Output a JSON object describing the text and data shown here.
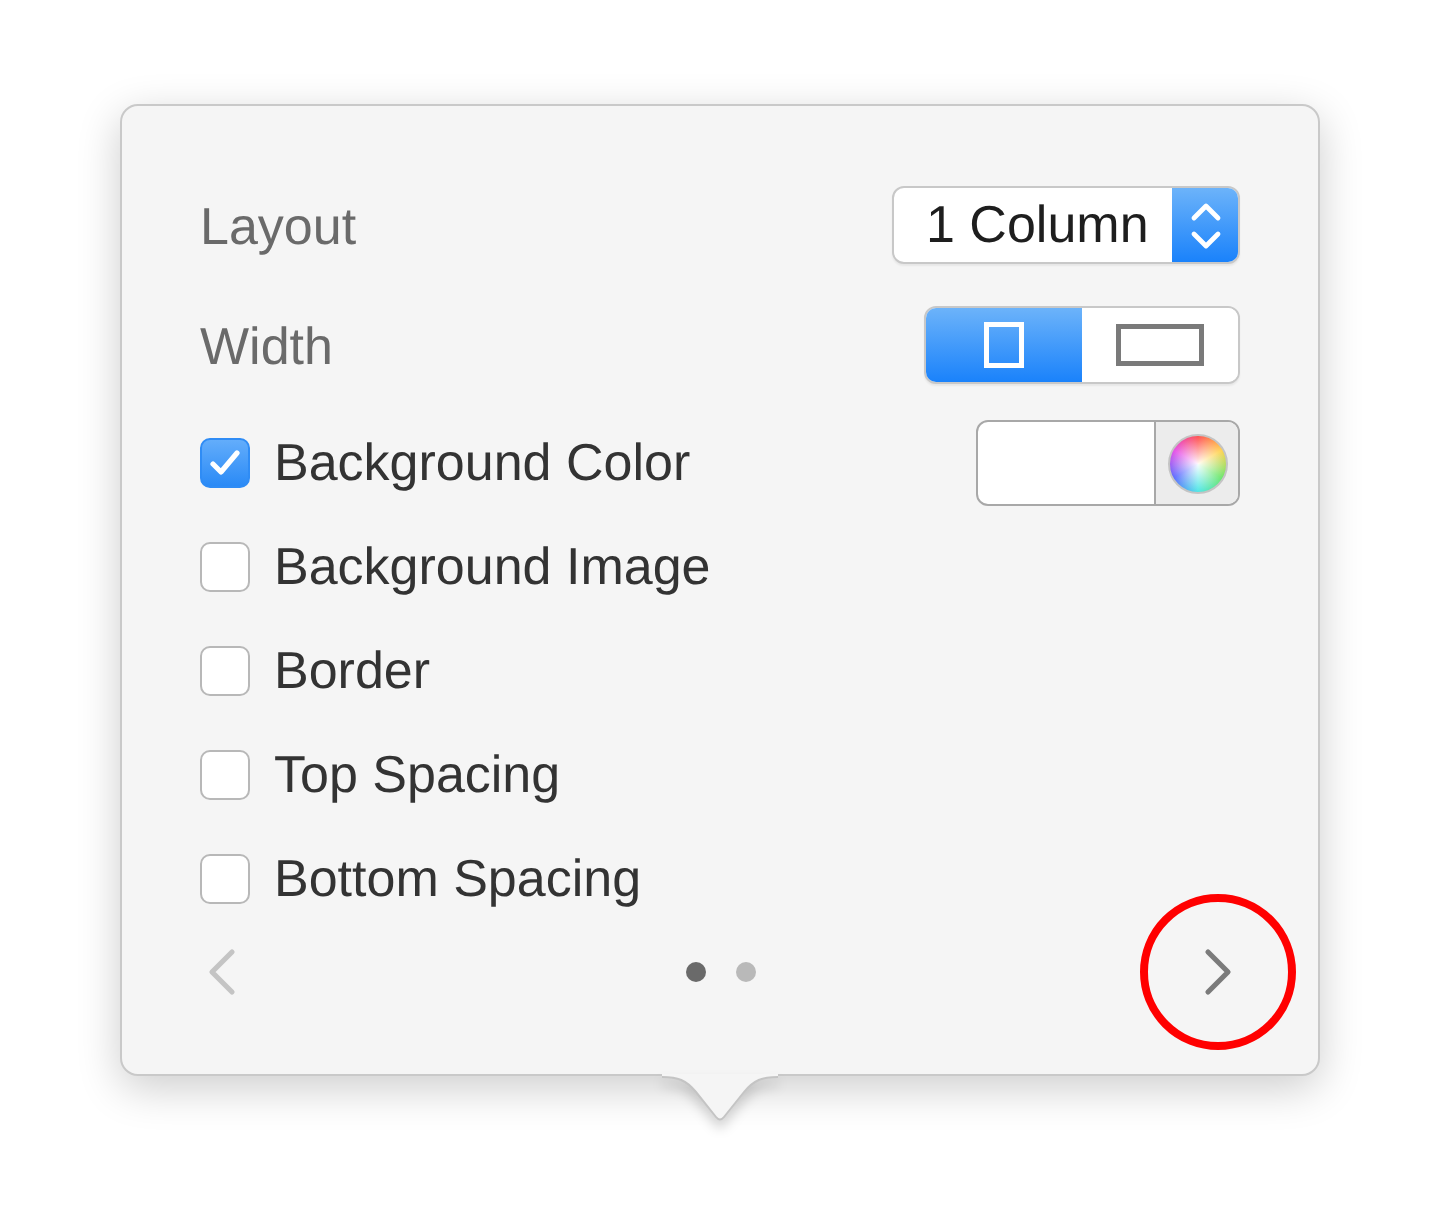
{
  "layout": {
    "label": "Layout",
    "value": "1 Column"
  },
  "width": {
    "label": "Width",
    "options": [
      {
        "kind": "narrow",
        "selected": true
      },
      {
        "kind": "wide",
        "selected": false
      }
    ]
  },
  "options": [
    {
      "label": "Background Color",
      "checked": true,
      "kind": "color"
    },
    {
      "label": "Background Image",
      "checked": false,
      "kind": "plain"
    },
    {
      "label": "Border",
      "checked": false,
      "kind": "plain"
    },
    {
      "label": "Top Spacing",
      "checked": false,
      "kind": "plain"
    },
    {
      "label": "Bottom Spacing",
      "checked": false,
      "kind": "plain"
    }
  ],
  "pager": {
    "previous": {
      "disabled": true
    },
    "next": {
      "disabled": false,
      "highlighted": true
    },
    "pages": [
      {
        "selected": true
      },
      {
        "selected": false
      }
    ]
  }
}
